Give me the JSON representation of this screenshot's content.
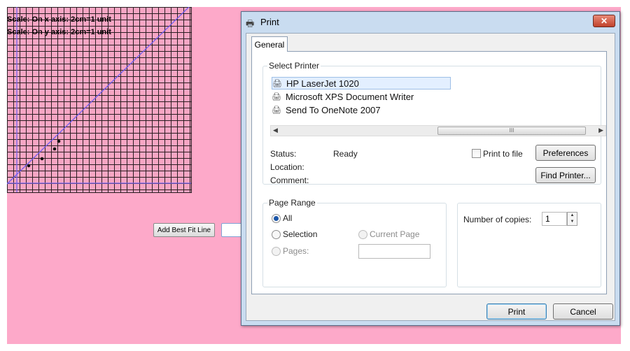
{
  "graph": {
    "scale_x": "Scale: On x axis: 2cm=1 unit",
    "scale_y": "Scale: On y axis: 2cm=1 unit"
  },
  "buttons": {
    "add_best_fit": "Add Best Fit Line",
    "blank": ""
  },
  "dialog": {
    "title": "Print",
    "close_glyph": "✕",
    "tab": "General",
    "select_printer": {
      "legend": "Select Printer",
      "printers": [
        "HP LaserJet 1020",
        "Microsoft XPS Document Writer",
        "Send To OneNote 2007"
      ],
      "selected": "HP LaserJet 1020",
      "scroll_thumb": "III"
    },
    "status": {
      "status_label": "Status:",
      "status_value": "Ready",
      "location_label": "Location:",
      "comment_label": "Comment:"
    },
    "print_to_file": "Print to file",
    "preferences": "Preferences",
    "find_printer": "Find Printer...",
    "page_range": {
      "legend": "Page Range",
      "all": "All",
      "selection": "Selection",
      "current_page": "Current Page",
      "pages": "Pages:",
      "selected_option": "All"
    },
    "copies": {
      "label": "Number of copies:",
      "value": "1"
    },
    "print_button": "Print",
    "cancel_button": "Cancel"
  },
  "colors": {
    "background": "#fda9c9",
    "dialog_frame": "#c9dcf0",
    "grid_line": "#2a1d22"
  }
}
